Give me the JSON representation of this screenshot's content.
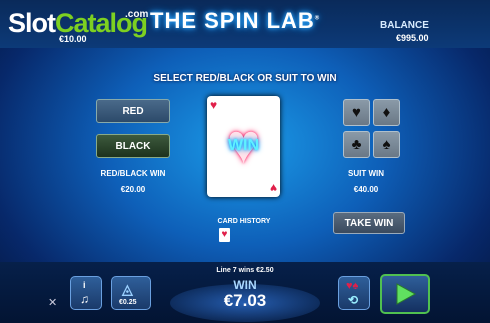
{
  "watermark": {
    "part1": "Slot",
    "part2": "Catalog",
    "suffix": ".com"
  },
  "header": {
    "title": "THE SPIN LAB",
    "trademark": "®",
    "stake_value": "€10.00",
    "balance_label": "BALANCE",
    "balance_value": "€995.00"
  },
  "prompt": "SELECT RED/BLACK OR SUIT TO WIN",
  "color_panel": {
    "red_label": "RED",
    "black_label": "BLACK",
    "win_label": "RED/BLACK WIN",
    "win_value": "€20.00"
  },
  "card": {
    "corner_suit": "♥",
    "center_text": "WIN",
    "center_icon": "heart-icon"
  },
  "suit_panel": {
    "suits": [
      "♥",
      "♦",
      "♣",
      "♠"
    ],
    "win_label": "SUIT WIN",
    "win_value": "€40.00"
  },
  "take_win_label": "TAKE WIN",
  "history": {
    "label": "CARD HISTORY",
    "cards": [
      "♥"
    ]
  },
  "footer": {
    "last_win": "Line 7 wins €2.50",
    "win_label": "WIN",
    "win_value": "€7.03",
    "stake_value": "€0.25"
  },
  "colors": {
    "accent": "#1b9be8",
    "heart": "#e0204a",
    "win_glow": "#5ff0ff",
    "play_border": "#50c050"
  }
}
